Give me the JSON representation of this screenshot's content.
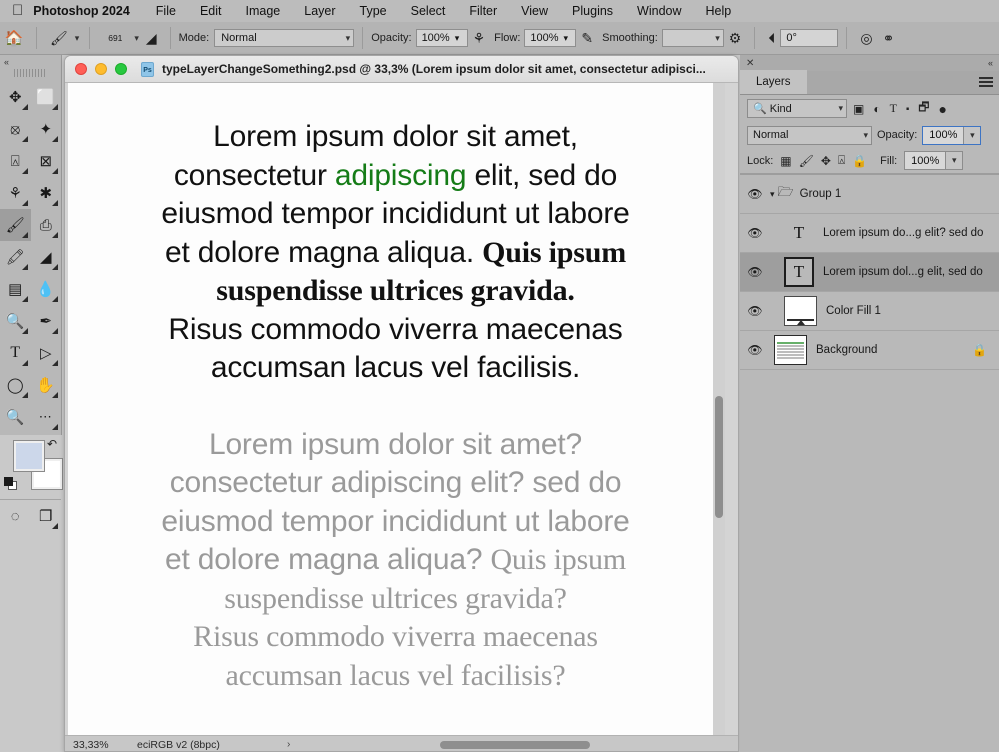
{
  "menubar": {
    "apple_icon": "apple-logo",
    "app_name": "Photoshop 2024",
    "items": [
      "File",
      "Edit",
      "Image",
      "Layer",
      "Type",
      "Select",
      "Filter",
      "View",
      "Plugins",
      "Window",
      "Help"
    ]
  },
  "options_bar": {
    "home_icon": "home-icon",
    "tool_preset_icon": "brush-preset-icon",
    "brush_size": "691",
    "brush_settings_icon": "brush-panel-icon",
    "mode_label": "Mode:",
    "mode_value": "Normal",
    "opacity_label": "Opacity:",
    "opacity_value": "100%",
    "airbrush_icon": "airbrush-icon",
    "flow_label": "Flow:",
    "flow_value": "100%",
    "tablet_pressure_icon": "tablet-pressure-icon",
    "smoothing_label": "Smoothing:",
    "smoothing_value": "",
    "smoothing_gear_icon": "gear-icon",
    "angle_icon": "angle-icon",
    "angle_value": "0°",
    "symmetry_icon": "symmetry-target-icon",
    "butterfly_icon": "butterfly-symmetry-icon"
  },
  "tools": {
    "collapse_icon": "collapse-chevrons-icon",
    "items": [
      {
        "name": "move-tool",
        "glyph": "✥",
        "active": false
      },
      {
        "name": "rectangular-marquee-tool",
        "glyph": "⬚",
        "active": false
      },
      {
        "name": "lasso-tool",
        "glyph": "⨳",
        "active": false
      },
      {
        "name": "object-selection-tool",
        "glyph": "✨",
        "active": false
      },
      {
        "name": "crop-tool",
        "glyph": "⌗",
        "active": false
      },
      {
        "name": "frame-tool",
        "glyph": "⊠",
        "active": false
      },
      {
        "name": "eyedropper-tool",
        "glyph": "⌖",
        "active": false
      },
      {
        "name": "spot-healing-brush-tool",
        "glyph": "✎",
        "active": false
      },
      {
        "name": "brush-tool",
        "glyph": "🖌",
        "active": true
      },
      {
        "name": "clone-stamp-tool",
        "glyph": "⎙",
        "active": false
      },
      {
        "name": "history-brush-tool",
        "glyph": "🖍",
        "active": false
      },
      {
        "name": "eraser-tool",
        "glyph": "◤",
        "active": false
      },
      {
        "name": "gradient-tool",
        "glyph": "▤",
        "active": false
      },
      {
        "name": "blur-tool",
        "glyph": "◌",
        "active": false
      },
      {
        "name": "dodge-tool",
        "glyph": "🔍",
        "active": false
      },
      {
        "name": "pen-tool",
        "glyph": "✒",
        "active": false
      },
      {
        "name": "horizontal-type-tool",
        "glyph": "T",
        "active": false
      },
      {
        "name": "path-selection-tool",
        "glyph": "▹",
        "active": false
      },
      {
        "name": "ellipse-tool",
        "glyph": "◯",
        "active": false
      },
      {
        "name": "hand-tool",
        "glyph": "✋",
        "active": false
      },
      {
        "name": "zoom-tool",
        "glyph": "🔎",
        "active": false
      },
      {
        "name": "edit-toolbar-tool",
        "glyph": "•••",
        "active": false
      }
    ],
    "foreground_color": "#ccd7ea",
    "background_color": "#ffffff",
    "swap_icon": "swap-colors-icon",
    "default_colors_icon": "default-colors-icon",
    "quick_mask_icon": "quick-mask-icon",
    "screen_mode_icon": "screen-mode-icon"
  },
  "document": {
    "traffic_lights": [
      "close",
      "minimize",
      "zoom"
    ],
    "file_icon": "psd-file-icon",
    "title": "typeLayerChangeSomething2.psd @ 33,3% (Lorem ipsum dolor sit amet, consectetur adipisci...",
    "status_zoom": "33,33%",
    "status_profile": "eciRGB v2 (8bpc)",
    "status_arrow": "›",
    "canvas": {
      "text_block_top": {
        "color": "#111111",
        "accent_color": "#157c17",
        "lines": [
          [
            {
              "t": "Lorem ipsum dolor sit amet,",
              "style": "sans"
            }
          ],
          [
            {
              "t": "consectetur ",
              "style": "sans"
            },
            {
              "t": "adipiscing",
              "style": "sans-green"
            },
            {
              "t": " elit, sed do",
              "style": "sans"
            }
          ],
          [
            {
              "t": "eiusmod tempor incididunt ut labore",
              "style": "sans"
            }
          ],
          [
            {
              "t": "et dolore magna aliqua. ",
              "style": "sans"
            },
            {
              "t": "Quis ipsum",
              "style": "serif"
            }
          ],
          [
            {
              "t": "suspendisse ultrices gravida.",
              "style": "serif"
            }
          ],
          [
            {
              "t": "Risus commodo viverra maecenas",
              "style": "sans"
            }
          ],
          [
            {
              "t": "accumsan lacus vel facilisis.",
              "style": "sans"
            }
          ]
        ]
      },
      "text_block_bottom": {
        "color": "#9a9a9a",
        "lines": [
          [
            {
              "t": "Lorem ipsum dolor sit amet?",
              "style": "sans"
            }
          ],
          [
            {
              "t": "consectetur adipiscing elit? sed do",
              "style": "sans"
            }
          ],
          [
            {
              "t": "eiusmod tempor incididunt ut labore",
              "style": "sans"
            }
          ],
          [
            {
              "t": "et dolore magna aliqua? ",
              "style": "sans"
            },
            {
              "t": "Quis ipsum",
              "style": "serif"
            }
          ],
          [
            {
              "t": "suspendisse ultrices gravida?",
              "style": "serif"
            }
          ],
          [
            {
              "t": "Risus commodo viverra maecenas",
              "style": "serif"
            }
          ],
          [
            {
              "t": "accumsan lacus vel facilisis?",
              "style": "serif"
            }
          ]
        ]
      }
    }
  },
  "layers_panel": {
    "close_icon": "close-icon",
    "collapse_icon": "collapse-panel-icon",
    "tab_label": "Layers",
    "menu_icon": "panel-menu-icon",
    "filter": {
      "search_icon": "search-icon",
      "kind_label": "Kind",
      "chevron_icon": "chevron-down-icon",
      "icons": [
        {
          "name": "filter-pixel-icon",
          "glyph": "▣"
        },
        {
          "name": "filter-adjustment-icon",
          "glyph": "◐"
        },
        {
          "name": "filter-type-icon",
          "glyph": "T"
        },
        {
          "name": "filter-shape-icon",
          "glyph": "⬚"
        },
        {
          "name": "filter-smart-object-icon",
          "glyph": "🗗"
        }
      ],
      "toggle_icon": "filter-toggle-switch"
    },
    "blend_mode": "Normal",
    "blend_chevron_icon": "chevron-down-icon",
    "opacity_label": "Opacity:",
    "opacity_value": "100%",
    "opacity_chevron_icon": "chevron-down-icon",
    "lock_label": "Lock:",
    "lock_icons": [
      {
        "name": "lock-transparent-pixels-icon",
        "glyph": "▨"
      },
      {
        "name": "lock-image-pixels-icon",
        "glyph": "🖌"
      },
      {
        "name": "lock-position-icon",
        "glyph": "✥"
      },
      {
        "name": "lock-artboard-nesting-icon",
        "glyph": "⌗"
      },
      {
        "name": "lock-all-icon",
        "glyph": "🔒"
      }
    ],
    "fill_label": "Fill:",
    "fill_value": "100%",
    "fill_chevron_icon": "chevron-down-icon",
    "layers": [
      {
        "type": "group",
        "name": "Group 1",
        "visible": true,
        "selected": false,
        "expanded": true,
        "eye_icon": "eye-icon",
        "disclosure_icon": "chevron-down-icon",
        "folder_icon": "folder-icon"
      },
      {
        "type": "text",
        "name": "Lorem ipsum do...g elit? sed do",
        "visible": true,
        "selected": false,
        "eye_icon": "eye-icon",
        "thumb_glyph": "T",
        "thumb_name": "type-layer-thumbnail"
      },
      {
        "type": "text",
        "name": "Lorem ipsum dol...g elit, sed do",
        "visible": true,
        "selected": true,
        "eye_icon": "eye-icon",
        "thumb_glyph": "T",
        "thumb_name": "type-layer-thumbnail"
      },
      {
        "type": "fill",
        "name": "Color Fill 1",
        "visible": true,
        "selected": false,
        "eye_icon": "eye-icon",
        "thumb_name": "color-fill-thumbnail"
      },
      {
        "type": "background",
        "name": "Background",
        "visible": true,
        "selected": false,
        "locked": true,
        "eye_icon": "eye-icon",
        "thumb_name": "background-layer-thumbnail",
        "lock_icon": "lock-icon"
      }
    ]
  }
}
